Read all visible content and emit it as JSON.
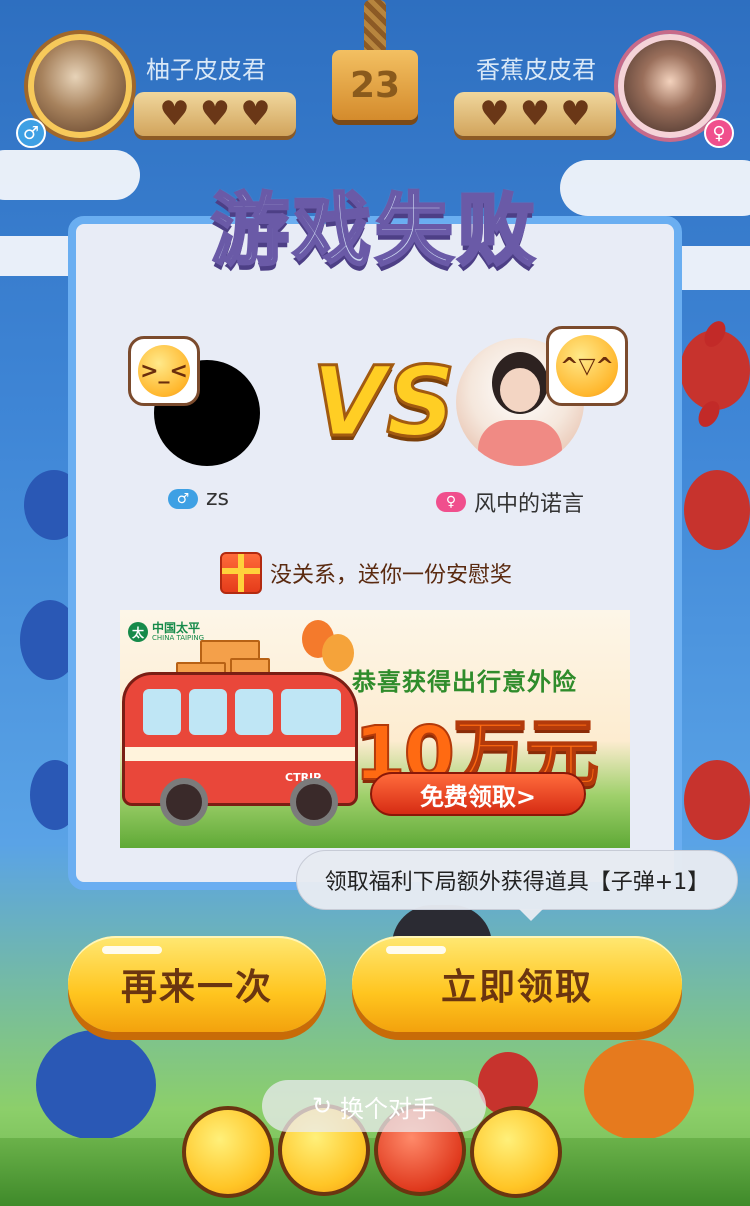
{
  "timer": {
    "value": "23"
  },
  "player_left": {
    "name": "柚子皮皮君",
    "gender_symbol": "♂",
    "gender_color": "#3ea0e4",
    "lives": 3
  },
  "player_right": {
    "name": "香蕉皮皮君",
    "gender_symbol": "♀",
    "gender_color": "#f04f8d",
    "lives": 3
  },
  "result": {
    "title": "游戏失败"
  },
  "match": {
    "vs_label": "VS",
    "left": {
      "name": "zs",
      "gender_symbol": "♂",
      "gender_color": "#3ea0e4",
      "emoji": "crying-face-icon"
    },
    "right": {
      "name": "风中的诺言",
      "gender_symbol": "♀",
      "gender_color": "#f04f8d",
      "emoji": "laughing-face-icon"
    }
  },
  "consolation": {
    "text": "没关系，送你一份安慰奖"
  },
  "ad": {
    "brand": "中国太平",
    "brand_en": "CHINA TAIPING",
    "headline": "恭喜获得出行意外险",
    "amount": "10万元",
    "cta": "免费领取>",
    "bus_label": "CTRIP"
  },
  "tooltip": {
    "text": "领取福利下局额外获得道具【子弹+1】"
  },
  "buttons": {
    "retry": "再来一次",
    "claim": "立即领取",
    "switch_opponent": "换个对手"
  },
  "colors": {
    "panel_border": "#6aaef1",
    "button_yellow": "#ffc51f",
    "title_outline": "#6a5aa7"
  }
}
